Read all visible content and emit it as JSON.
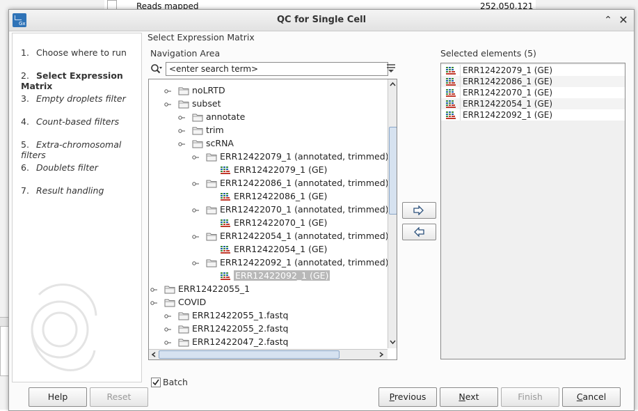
{
  "background": {
    "cell_left": "Reads mapped",
    "cell_right": "252,050,121"
  },
  "dialog": {
    "title": "QC for Single Cell",
    "icon_text": "Gx"
  },
  "steps": [
    {
      "num": "1.",
      "label": "Choose where to run"
    },
    {
      "num": "2.",
      "label": "Select Expression Matrix"
    },
    {
      "num": "3.",
      "label": "Empty droplets filter"
    },
    {
      "num": "4.",
      "label": "Count-based filters"
    },
    {
      "num": "5.",
      "label": "Extra-chromosomal filters"
    },
    {
      "num": "6.",
      "label": "Doublets filter"
    },
    {
      "num": "7.",
      "label": "Result handling"
    }
  ],
  "main": {
    "section_title": "Select Expression Matrix",
    "nav_label": "Navigation Area",
    "search_placeholder": "<enter search term>",
    "selected_label": "Selected elements (5)",
    "batch_label": "Batch"
  },
  "tree": [
    {
      "label": "noLRTD",
      "type": "folder"
    },
    {
      "label": "subset",
      "type": "folder"
    },
    {
      "label": "annotate",
      "type": "folder"
    },
    {
      "label": "trim",
      "type": "folder"
    },
    {
      "label": "scRNA",
      "type": "folder"
    },
    {
      "label": "ERR12422079_1 (annotated, trimmed)",
      "type": "folder"
    },
    {
      "label": "ERR12422079_1 (GE)",
      "type": "matrix"
    },
    {
      "label": "ERR12422086_1 (annotated, trimmed)",
      "type": "folder"
    },
    {
      "label": "ERR12422086_1 (GE)",
      "type": "matrix"
    },
    {
      "label": "ERR12422070_1 (annotated, trimmed)",
      "type": "folder"
    },
    {
      "label": "ERR12422070_1 (GE)",
      "type": "matrix"
    },
    {
      "label": "ERR12422054_1 (annotated, trimmed)",
      "type": "folder"
    },
    {
      "label": "ERR12422054_1 (GE)",
      "type": "matrix"
    },
    {
      "label": "ERR12422092_1 (annotated, trimmed)",
      "type": "folder"
    },
    {
      "label": "ERR12422092_1 (GE)",
      "type": "matrix",
      "selected": true
    },
    {
      "label": "ERR12422055_1",
      "type": "folder"
    },
    {
      "label": "COVID",
      "type": "folder"
    },
    {
      "label": "ERR12422055_1.fastq",
      "type": "folder"
    },
    {
      "label": "ERR12422055_2.fastq",
      "type": "folder"
    },
    {
      "label": "ERR12422047_2.fastq",
      "type": "folder"
    }
  ],
  "selected": [
    "ERR12422079_1 (GE)",
    "ERR12422086_1 (GE)",
    "ERR12422070_1 (GE)",
    "ERR12422054_1 (GE)",
    "ERR12422092_1 (GE)"
  ],
  "footer": {
    "help": "Help",
    "reset": "Reset",
    "previous_mn": "P",
    "previous_rest": "revious",
    "next_mn": "N",
    "next_rest": "ext",
    "finish": "Finish",
    "cancel_mn": "C",
    "cancel_rest": "ancel"
  },
  "colors": {
    "accent": "#2f73b7",
    "matrix_green": "#3a8a3a",
    "matrix_red": "#c0392b"
  }
}
